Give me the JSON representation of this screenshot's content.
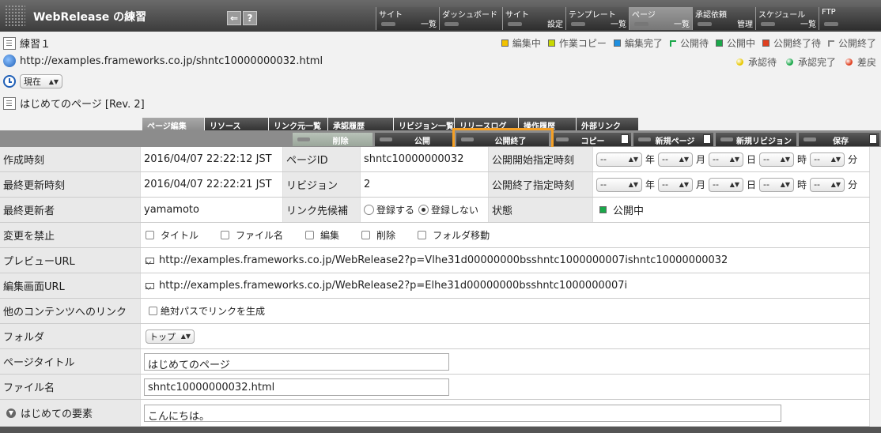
{
  "header": {
    "title": "WebRelease の練習",
    "nav": [
      {
        "top": "サイト",
        "bottom": "一覧",
        "active": false
      },
      {
        "top": "ダッシュボード",
        "bottom": "",
        "active": false
      },
      {
        "top": "サイト",
        "bottom": "設定",
        "active": false
      },
      {
        "top": "テンプレート",
        "bottom": "一覧",
        "active": false
      },
      {
        "top": "ページ",
        "bottom": "一覧",
        "active": true
      },
      {
        "top": "承認依頼",
        "bottom": "管理",
        "active": false
      },
      {
        "top": "スケジュール",
        "bottom": "一覧",
        "active": false
      },
      {
        "top": "FTP",
        "bottom": "",
        "active": false
      }
    ],
    "help": "?"
  },
  "info": {
    "page_name": "練習１",
    "url": "http://examples.frameworks.co.jp/shntc10000000032.html",
    "time_select": "現在",
    "page_rev": "はじめてのページ [Rev. 2]"
  },
  "legend_status": [
    {
      "label": "編集中",
      "color": "#f2c200",
      "kind": "square"
    },
    {
      "label": "作業コピー",
      "color": "#c8d800",
      "kind": "square"
    },
    {
      "label": "編集完了",
      "color": "#1e8fe0",
      "kind": "square"
    },
    {
      "label": "公開待",
      "color": "#1aa84a",
      "kind": "hollow"
    },
    {
      "label": "公開中",
      "color": "#1aa84a",
      "kind": "square"
    },
    {
      "label": "公開終了待",
      "color": "#e04020",
      "kind": "square"
    },
    {
      "label": "公開終了",
      "color": "#888888",
      "kind": "hollow"
    }
  ],
  "legend_approval": [
    {
      "label": "承認待",
      "color": "#e8c800"
    },
    {
      "label": "承認完了",
      "color": "#1aa84a"
    },
    {
      "label": "差戻",
      "color": "#e04020"
    }
  ],
  "tabs": [
    "ページ編集",
    "リソース",
    "リンク元一覧",
    "承認履歴",
    "リビジョン一覧",
    "リリースログ",
    "操作履歴",
    "外部リンク"
  ],
  "actions": {
    "delete": "削除",
    "publish": "公開",
    "unpublish": "公開終了",
    "copy": "コピー",
    "new_page": "新規ページ",
    "new_revision": "新規リビジョン",
    "save": "保存"
  },
  "form": {
    "created_label": "作成時刻",
    "created_value": "2016/04/07 22:22:12 JST",
    "pageid_label": "ページID",
    "pageid_value": "shntc10000000032",
    "pub_start_label": "公開開始指定時刻",
    "updated_label": "最終更新時刻",
    "updated_value": "2016/04/07 22:22:21 JST",
    "revision_label": "リビジョン",
    "revision_value": "2",
    "pub_end_label": "公開終了指定時刻",
    "updater_label": "最終更新者",
    "updater_value": "yamamoto",
    "link_label": "リンク先候補",
    "link_opt_register": "登録する",
    "link_opt_noregister": "登録しない",
    "state_label": "状態",
    "state_value": "公開中",
    "lock_label": "変更を禁止",
    "lock_opts": [
      "タイトル",
      "ファイル名",
      "編集",
      "削除",
      "フォルダ移動"
    ],
    "preview_label": "プレビューURL",
    "preview_url": "http://examples.frameworks.co.jp/WebRelease2?p=Vlhe31d00000000bsshntc1000000007ishntc10000000032",
    "edit_label": "編集画面URL",
    "edit_url": "http://examples.frameworks.co.jp/WebRelease2?p=Elhe31d00000000bsshntc1000000007i",
    "other_link_label": "他のコンテンツへのリンク",
    "other_link_opt": "絶対パスでリンクを生成",
    "folder_label": "フォルダ",
    "folder_value": "トップ",
    "title_label": "ページタイトル",
    "title_value": "はじめてのページ",
    "filename_label": "ファイル名",
    "filename_value": "shntc10000000032.html",
    "element_label": "はじめての要素",
    "element_value": "こんにちは。",
    "dt_placeholder": "--",
    "units": [
      "年",
      "月",
      "日",
      "時",
      "分"
    ]
  }
}
